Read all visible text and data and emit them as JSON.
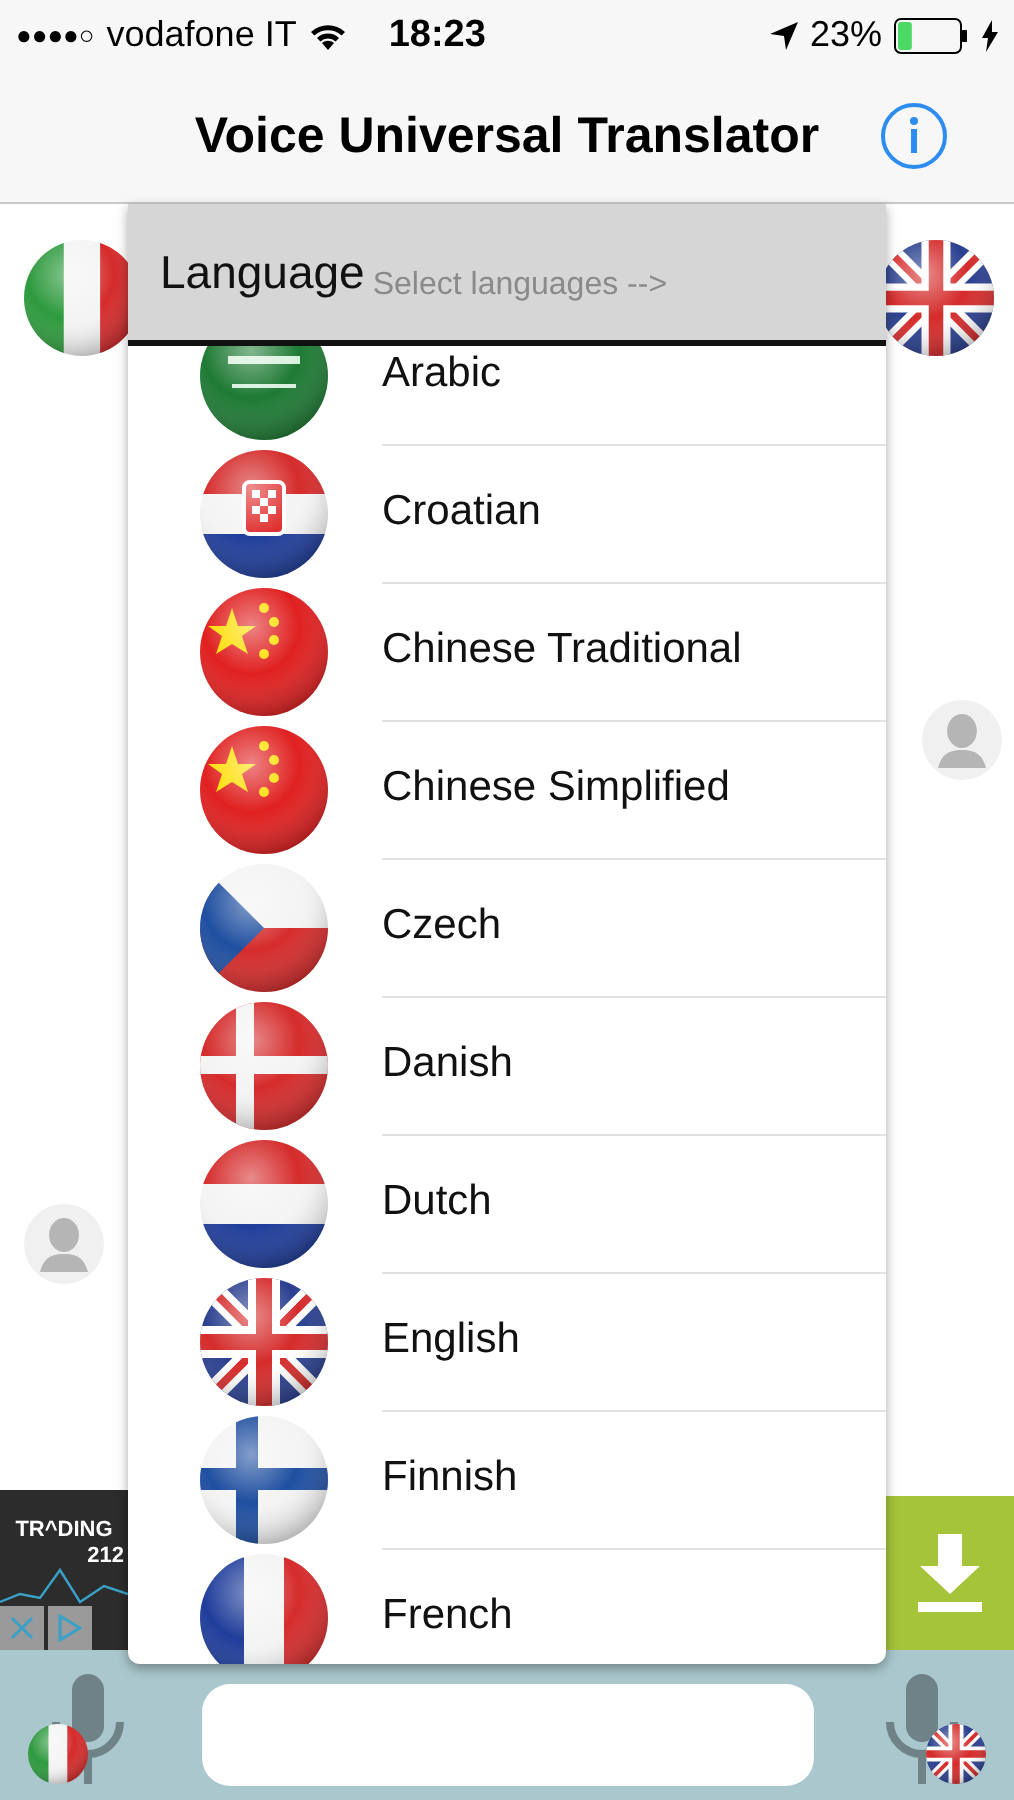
{
  "status_bar": {
    "signal": "●●●●○",
    "carrier": "vodafone IT",
    "time": "18:23",
    "battery_text": "23%",
    "battery": {
      "level": 0.23
    },
    "charging": true
  },
  "nav_bar": {
    "title": "Voice Universal Translator"
  },
  "chat": {
    "source_flag": {
      "kind": "it"
    },
    "target_flag": {
      "kind": "gb"
    }
  },
  "dropdown": {
    "title": "Language",
    "hint": "Select languages -->",
    "items": [
      {
        "label": "Arabic",
        "kind": "sa"
      },
      {
        "label": "Croatian",
        "kind": "hr"
      },
      {
        "label": "Chinese Traditional",
        "kind": "cn"
      },
      {
        "label": "Chinese Simplified",
        "kind": "cn"
      },
      {
        "label": "Czech",
        "kind": "cz"
      },
      {
        "label": "Danish",
        "kind": "dk"
      },
      {
        "label": "Dutch",
        "kind": "nl"
      },
      {
        "label": "English",
        "kind": "gb"
      },
      {
        "label": "Finnish",
        "kind": "fi"
      },
      {
        "label": "French",
        "kind": "fr"
      }
    ]
  },
  "ad": {
    "brand": "TR^DING",
    "brand_line2": "212"
  },
  "input_bar": {
    "left_flag": {
      "kind": "it"
    },
    "right_flag": {
      "kind": "gb"
    }
  }
}
